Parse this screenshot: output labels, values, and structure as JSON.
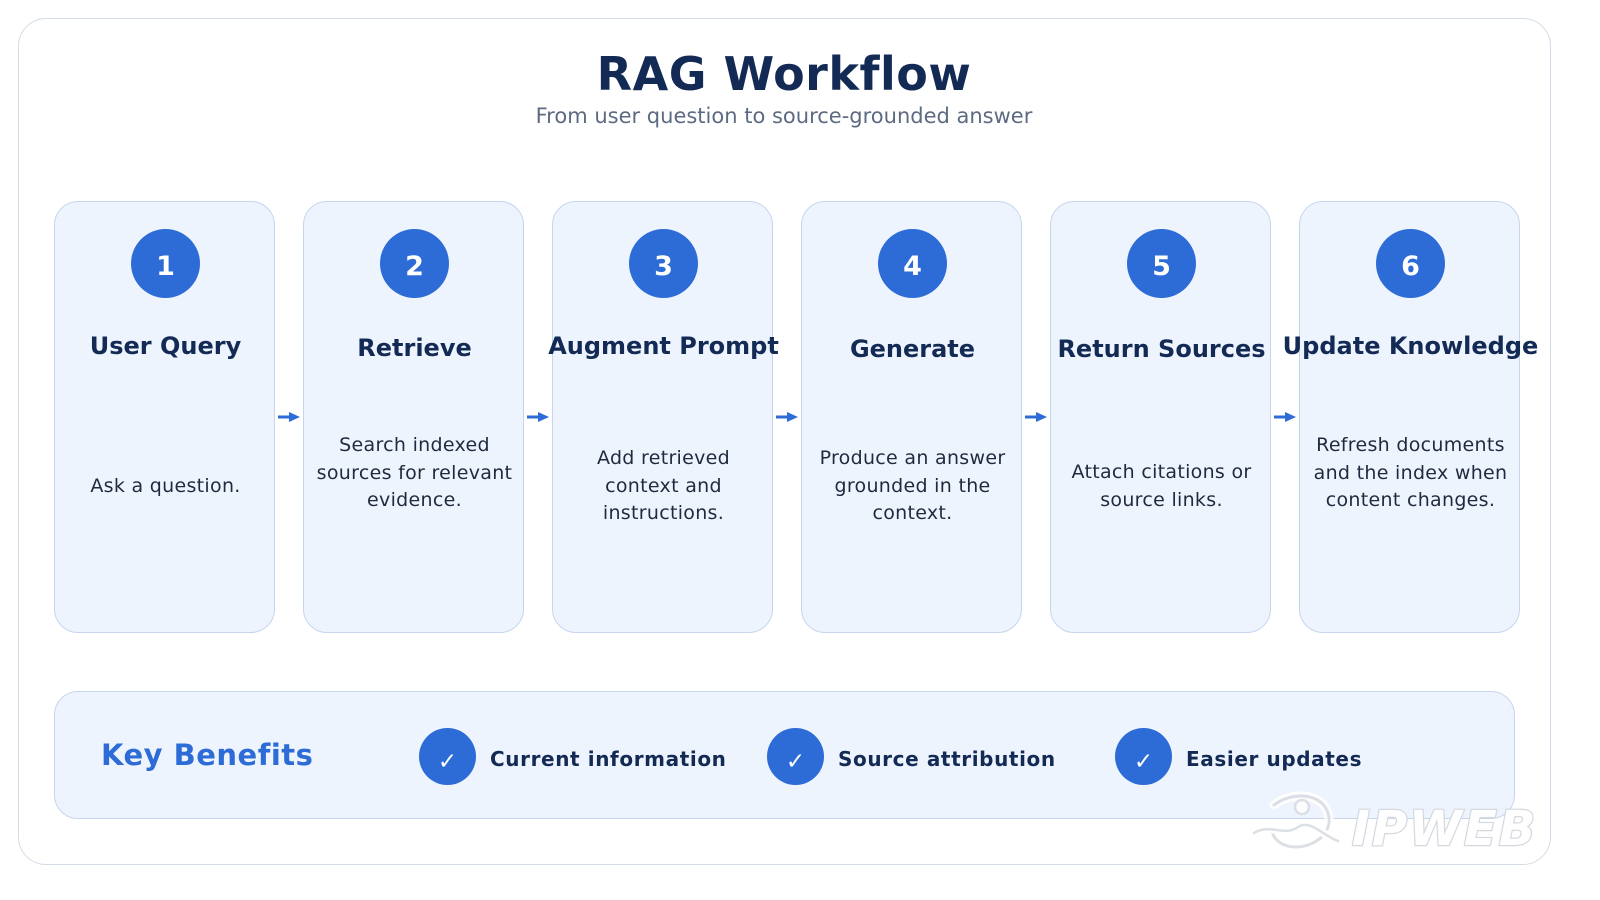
{
  "header": {
    "title": "RAG Workflow",
    "subtitle": "From user question to source-grounded answer"
  },
  "steps": [
    {
      "number": "1",
      "title": "User Query",
      "description": "Ask a question."
    },
    {
      "number": "2",
      "title": "Retrieve",
      "description": "Search indexed sources for relevant evidence."
    },
    {
      "number": "3",
      "title": "Augment Prompt",
      "description": "Add retrieved context and instructions."
    },
    {
      "number": "4",
      "title": "Generate",
      "description": "Produce an answer grounded in the context."
    },
    {
      "number": "5",
      "title": "Return Sources",
      "description": "Attach citations or source links."
    },
    {
      "number": "6",
      "title": "Update Knowledge",
      "description": "Refresh documents and the index when content changes."
    }
  ],
  "benefits": {
    "title": "Key Benefits",
    "items": [
      {
        "icon": "check-icon",
        "label": "Current information"
      },
      {
        "icon": "check-icon",
        "label": "Source attribution"
      },
      {
        "icon": "check-icon",
        "label": "Easier updates"
      }
    ]
  },
  "watermark": {
    "text": "IPWEB"
  },
  "colors": {
    "accent": "#2d6bd6",
    "title": "#132a55",
    "card_bg": "#eef4fe",
    "card_border": "#c6d5ee"
  }
}
